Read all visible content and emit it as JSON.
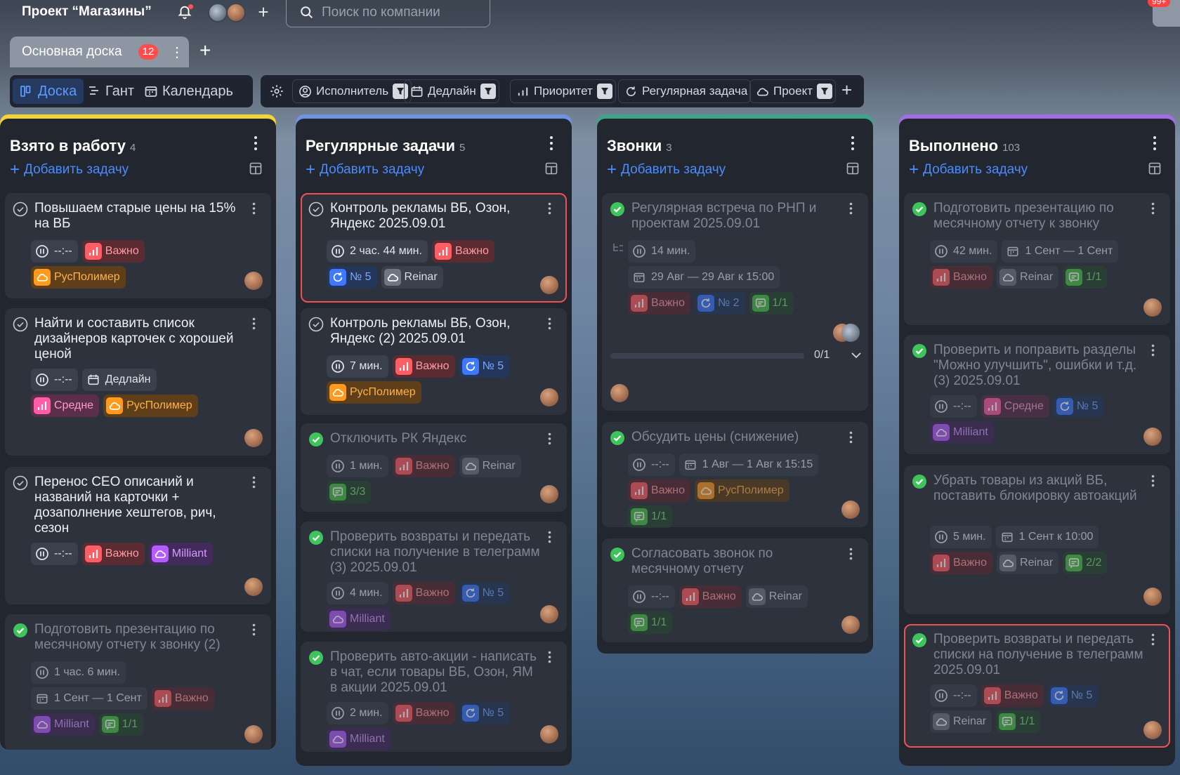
{
  "header": {
    "project_title": "Проект “Магазины”",
    "search_placeholder": "Поиск по компании",
    "notifications_badge": "99+"
  },
  "tabs": [
    {
      "label": "Основная доска",
      "badge": "12"
    }
  ],
  "views": [
    {
      "label": "Доска",
      "icon": "board-icon",
      "active": true
    },
    {
      "label": "Гант",
      "icon": "gantt-icon",
      "active": false
    },
    {
      "label": "Календарь",
      "icon": "calendar-icon",
      "active": false
    }
  ],
  "filters": [
    {
      "label": "Исполнитель",
      "icon": "user-icon"
    },
    {
      "label": "Дедлайн",
      "icon": "calendar-icon"
    },
    {
      "label": "Приоритет",
      "icon": "priority-icon"
    },
    {
      "label": "Регулярная задача",
      "icon": "repeat-icon"
    },
    {
      "label": "Проект",
      "icon": "cloud-icon"
    }
  ],
  "add_task_label": "Добавить задачу",
  "columns": [
    {
      "title": "Взято в работу",
      "count": "4",
      "accent": "#f2d43a",
      "cards": [
        {
          "title": "Повышаем старые цены на 15% на ВБ",
          "done": false,
          "rows": [
            [
              {
                "t": "time",
                "text": "--:--"
              },
              {
                "t": "red",
                "text": "Важно"
              }
            ],
            [
              {
                "t": "orange",
                "text": "РусПолимер"
              }
            ]
          ]
        },
        {
          "title": "Найти и составить список дизайнеров карточек с хорошей ценой",
          "done": false,
          "rows": [
            [
              {
                "t": "time",
                "text": "--:--"
              },
              {
                "t": "deadline",
                "text": "Дедлайн"
              }
            ],
            [
              {
                "t": "pink",
                "text": "Средне"
              },
              {
                "t": "orange",
                "text": "РусПолимер"
              }
            ]
          ]
        },
        {
          "title": "Перенос СЕО описаний и названий на карточки + дозаполнение хештегов, рич, сезон",
          "done": false,
          "rows": [
            [
              {
                "t": "time",
                "text": "--:--"
              },
              {
                "t": "red",
                "text": "Важно"
              },
              {
                "t": "purple",
                "text": "Milliant"
              }
            ]
          ]
        },
        {
          "title": "Подготовить презентацию по месячному отчету к звонку (2)",
          "done": true,
          "rows": [
            [
              {
                "t": "time",
                "text": "1 час. 6 мин."
              }
            ],
            [
              {
                "t": "date",
                "text": "1 Сент — 1 Сент"
              },
              {
                "t": "red",
                "text": "Важно"
              }
            ],
            [
              {
                "t": "purple",
                "text": "Milliant"
              },
              {
                "t": "green",
                "text": "1/1"
              }
            ]
          ]
        }
      ]
    },
    {
      "title": "Регулярные задачи",
      "count": "5",
      "accent": "#6f93e0",
      "cards": [
        {
          "title": "Контроль рекламы ВБ, Озон, Яндекс 2025.09.01",
          "done": false,
          "selected": true,
          "rows": [
            [
              {
                "t": "time",
                "text": "2 час. 44 мин."
              },
              {
                "t": "red",
                "text": "Важно"
              }
            ],
            [
              {
                "t": "blue",
                "text": "№ 5"
              },
              {
                "t": "gray",
                "text": "Reinar"
              }
            ]
          ]
        },
        {
          "title": "Контроль рекламы ВБ, Озон, Яндекс (2) 2025.09.01",
          "done": false,
          "rows": [
            [
              {
                "t": "time",
                "text": "7 мин."
              },
              {
                "t": "red",
                "text": "Важно"
              },
              {
                "t": "blue",
                "text": "№ 5"
              }
            ],
            [
              {
                "t": "orange",
                "text": "РусПолимер"
              }
            ]
          ]
        },
        {
          "title": "Отключить РК Яндекс",
          "done": true,
          "rows": [
            [
              {
                "t": "time",
                "text": "1 мин."
              },
              {
                "t": "red",
                "text": "Важно"
              },
              {
                "t": "gray",
                "text": "Reinar"
              }
            ],
            [
              {
                "t": "green",
                "text": "3/3"
              }
            ]
          ]
        },
        {
          "title": "Проверить возвраты и передать списки на получение в телеграмм (3) 2025.09.01",
          "done": true,
          "rows": [
            [
              {
                "t": "time",
                "text": "4 мин."
              },
              {
                "t": "red",
                "text": "Важно"
              },
              {
                "t": "blue",
                "text": "№ 5"
              }
            ],
            [
              {
                "t": "purple",
                "text": "Milliant"
              }
            ]
          ]
        },
        {
          "title": "Проверить авто-акции - написать в чат, если товары ВБ, Озон, ЯМ в акции 2025.09.01",
          "done": true,
          "rows": [
            [
              {
                "t": "time",
                "text": "2 мин."
              },
              {
                "t": "red",
                "text": "Важно"
              },
              {
                "t": "blue",
                "text": "№ 5"
              }
            ],
            [
              {
                "t": "purple",
                "text": "Milliant"
              }
            ]
          ]
        }
      ]
    },
    {
      "title": "Звонки",
      "count": "3",
      "accent": "#3fa58a",
      "cards": [
        {
          "title": "Регулярная встреча по РНП и проектам 2025.09.01",
          "done": true,
          "rows": [
            [
              {
                "t": "time",
                "text": "14 мин."
              }
            ],
            [
              {
                "t": "date",
                "text": "29 Авг — 29 Авг к 15:00"
              }
            ],
            [
              {
                "t": "red",
                "text": "Важно"
              },
              {
                "t": "blue",
                "text": "№ 2"
              },
              {
                "t": "green",
                "text": "1/1"
              }
            ]
          ],
          "progress": "0/1"
        },
        {
          "title": "Обсудить цены (снижение)",
          "done": true,
          "rows": [
            [
              {
                "t": "time",
                "text": "--:--"
              },
              {
                "t": "date",
                "text": "1 Авг — 1 Авг к 15:15"
              }
            ],
            [
              {
                "t": "red",
                "text": "Важно"
              },
              {
                "t": "orange",
                "text": "РусПолимер"
              }
            ],
            [
              {
                "t": "green",
                "text": "1/1"
              }
            ]
          ]
        },
        {
          "title": "Согласовать звонок по месячному отчету",
          "done": true,
          "rows": [
            [
              {
                "t": "time",
                "text": "--:--"
              },
              {
                "t": "red",
                "text": "Важно"
              },
              {
                "t": "gray",
                "text": "Reinar"
              }
            ],
            [
              {
                "t": "green",
                "text": "1/1"
              }
            ]
          ]
        }
      ]
    },
    {
      "title": "Выполнено",
      "count": "103",
      "accent": "#a06ee0",
      "cards": [
        {
          "title": "Подготовить презентацию по месячному отчету к звонку",
          "done": true,
          "rows": [
            [
              {
                "t": "time",
                "text": "42 мин."
              },
              {
                "t": "date",
                "text": "1 Сент — 1 Сент"
              }
            ],
            [
              {
                "t": "red",
                "text": "Важно"
              },
              {
                "t": "gray",
                "text": "Reinar"
              },
              {
                "t": "green",
                "text": "1/1"
              }
            ]
          ]
        },
        {
          "title": "Проверить и поправить разделы \"Можно улучшить\", ошибки и т.д. (3) 2025.09.01",
          "done": true,
          "rows": [
            [
              {
                "t": "time",
                "text": "--:--"
              },
              {
                "t": "pink",
                "text": "Средне"
              },
              {
                "t": "blue",
                "text": "№ 5"
              }
            ],
            [
              {
                "t": "purple",
                "text": "Milliant"
              }
            ]
          ]
        },
        {
          "title": "Убрать товары из акций ВБ, поставить блокировку автоакций",
          "done": true,
          "rows": [
            [
              {
                "t": "time",
                "text": "5 мин."
              },
              {
                "t": "date",
                "text": "1 Сент к 10:00"
              }
            ],
            [
              {
                "t": "red",
                "text": "Важно"
              },
              {
                "t": "gray",
                "text": "Reinar"
              },
              {
                "t": "green",
                "text": "2/2"
              }
            ]
          ]
        },
        {
          "title": "Проверить возвраты и передать списки на получение в телеграмм 2025.09.01",
          "done": true,
          "selected": true,
          "rows": [
            [
              {
                "t": "time",
                "text": "--:--"
              },
              {
                "t": "red",
                "text": "Важно"
              },
              {
                "t": "blue",
                "text": "№ 5"
              }
            ],
            [
              {
                "t": "gray",
                "text": "Reinar"
              },
              {
                "t": "green",
                "text": "1/1"
              }
            ]
          ]
        }
      ]
    }
  ]
}
